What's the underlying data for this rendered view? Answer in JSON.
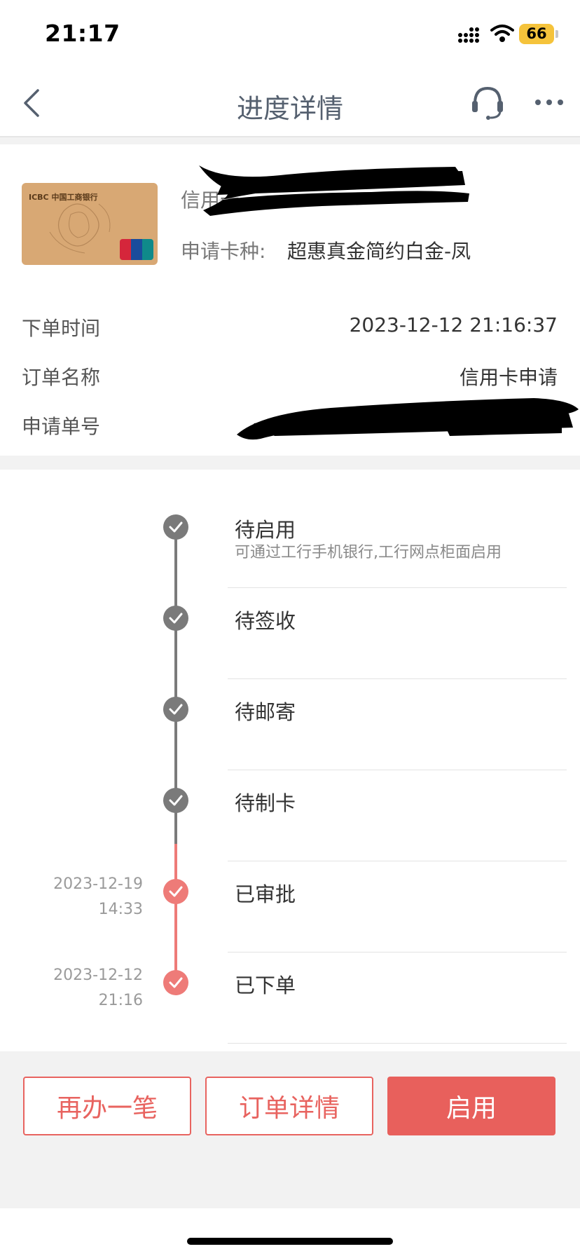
{
  "status_bar": {
    "time": "21:17",
    "battery": "66"
  },
  "nav": {
    "title": "进度详情"
  },
  "card": {
    "brand_text": "ICBC 中国工商银行",
    "title_label": "信用卡",
    "type_label": "申请卡种:",
    "type_value": "超惠真金简约白金-凤"
  },
  "order": {
    "time_label": "下单时间",
    "time_value": "2023-12-12 21:16:37",
    "name_label": "订单名称",
    "name_value": "信用卡申请",
    "number_label": "申请单号"
  },
  "timeline": [
    {
      "title": "待启用",
      "subtitle": "可通过工行手机银行,工行网点柜面启用",
      "date": "",
      "time": "",
      "status": "pending"
    },
    {
      "title": "待签收",
      "subtitle": "",
      "date": "",
      "time": "",
      "status": "pending"
    },
    {
      "title": "待邮寄",
      "subtitle": "",
      "date": "",
      "time": "",
      "status": "pending"
    },
    {
      "title": "待制卡",
      "subtitle": "",
      "date": "",
      "time": "",
      "status": "pending"
    },
    {
      "title": "已审批",
      "subtitle": "",
      "date": "2023-12-19",
      "time": "14:33",
      "status": "done"
    },
    {
      "title": "已下单",
      "subtitle": "",
      "date": "2023-12-12",
      "time": "21:16",
      "status": "done"
    }
  ],
  "colors": {
    "accent": "#e8605c",
    "pending": "#7a7a7a",
    "done": "#ee7b78"
  },
  "buttons": {
    "again": "再办一笔",
    "detail": "订单详情",
    "activate": "启用"
  }
}
